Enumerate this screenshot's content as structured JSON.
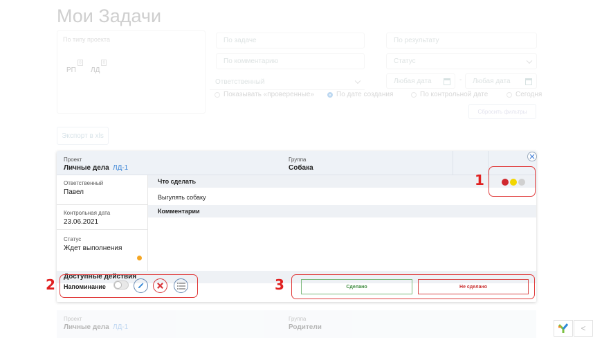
{
  "page": {
    "title": "Мои Задачи"
  },
  "filters": {
    "project_type_label": "По типу проекта",
    "tags": [
      {
        "label": "РП",
        "count": "0"
      },
      {
        "label": "ЛД",
        "count": "0"
      }
    ],
    "task_placeholder": "По задаче",
    "result_placeholder": "По результату",
    "comment_placeholder": "По комментарию",
    "status_placeholder": "Статус",
    "responsible_placeholder": "Ответственный",
    "date_from": "Любая дата",
    "date_sep": "-",
    "date_to": "Любая дата",
    "radios": [
      {
        "label": "Показывать «проверенные»",
        "selected": false
      },
      {
        "label": "По дате создания",
        "selected": true
      },
      {
        "label": "По контрольной дате",
        "selected": false
      },
      {
        "label": "Сегодня",
        "selected": false
      }
    ],
    "reset_label": "Сбросить фильтры"
  },
  "export_label": "Экспорт в xls",
  "task": {
    "project_label": "Проект",
    "project_name": "Личные дела",
    "project_code": "ЛД-1",
    "group_label": "Группа",
    "group_name": "Собака",
    "responsible_label": "Ответственный",
    "responsible_value": "Павел",
    "deadline_label": "Контрольная дата",
    "deadline_value": "23.06.2021",
    "status_label": "Статус",
    "status_value": "Ждет выполнения",
    "status_color": "#f5a623",
    "todo_label": "Что сделать",
    "todo_value": "Выгулять собаку",
    "comments_label": "Комментарии",
    "actions_label": "Доступные действия",
    "reminder_label": "Напоминание",
    "done_label": "Сделано",
    "not_done_label": "Не сделано",
    "priority_colors": [
      "#d0282e",
      "#f2d600",
      "#d0d0d0"
    ]
  },
  "annotations": [
    "1",
    "2",
    "3"
  ],
  "next_task": {
    "project_label": "Проект",
    "project_name": "Личные дела",
    "project_code": "ЛД-1",
    "group_label": "Группа",
    "group_name": "Родители"
  },
  "corner": {
    "chevron": "<"
  }
}
